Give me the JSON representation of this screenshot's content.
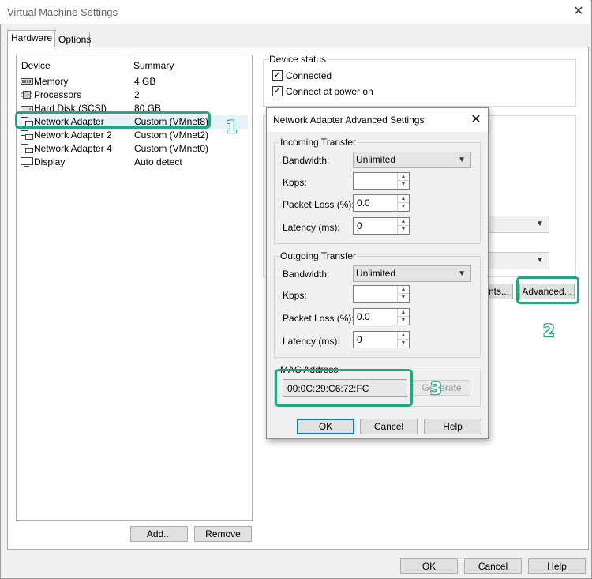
{
  "window": {
    "title": "Virtual Machine Settings",
    "close_symbol": "✕"
  },
  "tabs": [
    {
      "label": "Hardware",
      "active": true
    },
    {
      "label": "Options",
      "active": false
    }
  ],
  "device_list": {
    "headers": {
      "device": "Device",
      "summary": "Summary"
    },
    "rows": [
      {
        "icon": "memory-icon",
        "name": "Memory",
        "summary": "4 GB"
      },
      {
        "icon": "processor-icon",
        "name": "Processors",
        "summary": "2"
      },
      {
        "icon": "hard-disk-icon",
        "name": "Hard Disk (SCSI)",
        "summary": "80 GB"
      },
      {
        "icon": "network-adapter-icon",
        "name": "Network Adapter",
        "summary": "Custom (VMnet8)",
        "selected": true
      },
      {
        "icon": "network-adapter-icon",
        "name": "Network Adapter 2",
        "summary": "Custom (VMnet2)"
      },
      {
        "icon": "network-adapter-icon",
        "name": "Network Adapter 4",
        "summary": "Custom (VMnet0)"
      },
      {
        "icon": "display-icon",
        "name": "Display",
        "summary": "Auto detect"
      }
    ]
  },
  "list_buttons": {
    "add": "Add...",
    "remove": "Remove"
  },
  "device_status": {
    "label": "Device status",
    "connected": {
      "label": "Connected",
      "checked": true
    },
    "connect_at_power_on": {
      "label": "Connect at power on",
      "checked": true
    }
  },
  "right_panel": {
    "segments_partial_label": "nts...",
    "advanced_button": "Advanced..."
  },
  "dialog": {
    "title": "Network Adapter Advanced Settings",
    "close_symbol": "✕",
    "incoming": {
      "label": "Incoming Transfer",
      "bandwidth_label": "Bandwidth:",
      "bandwidth_value": "Unlimited",
      "kbps_label": "Kbps:",
      "kbps_value": "",
      "packet_loss_label": "Packet Loss (%):",
      "packet_loss_value": "0.0",
      "latency_label": "Latency (ms):",
      "latency_value": "0"
    },
    "outgoing": {
      "label": "Outgoing Transfer",
      "bandwidth_label": "Bandwidth:",
      "bandwidth_value": "Unlimited",
      "kbps_label": "Kbps:",
      "kbps_value": "",
      "packet_loss_label": "Packet Loss (%):",
      "packet_loss_value": "0.0",
      "latency_label": "Latency (ms):",
      "latency_value": "0"
    },
    "mac": {
      "label": "MAC Address",
      "value": "00:0C:29:C6:72:FC",
      "generate_button": "Generate"
    },
    "buttons": {
      "ok": "OK",
      "cancel": "Cancel",
      "help": "Help"
    }
  },
  "footer_buttons": {
    "ok": "OK",
    "cancel": "Cancel",
    "help": "Help"
  },
  "annotations": {
    "one": "1",
    "two": "2",
    "three": "3"
  },
  "colors": {
    "annotation": "#21a882",
    "selection": "#e5f1fb",
    "default_button_border": "#0078d7"
  }
}
